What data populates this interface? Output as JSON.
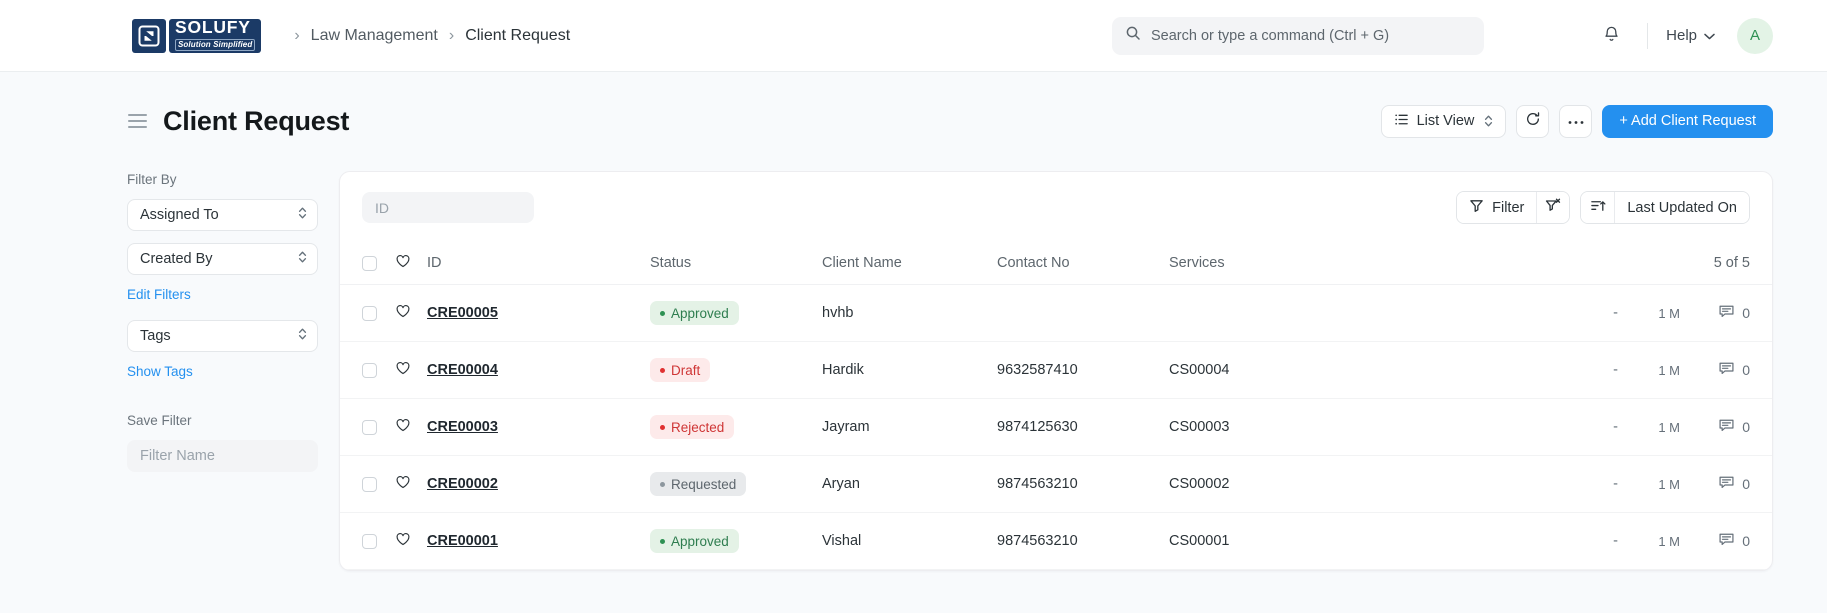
{
  "navbar": {
    "logo": {
      "name": "SOLUFY",
      "tagline": "Solution Simplified"
    },
    "breadcrumb": [
      {
        "label": "Law Management"
      },
      {
        "label": "Client Request"
      }
    ],
    "search": {
      "placeholder": "Search or type a command (Ctrl + G)",
      "value": ""
    },
    "help_label": "Help",
    "avatar_initial": "A"
  },
  "page": {
    "title": "Client Request",
    "actions": {
      "list_view_label": "List View",
      "add_label": "+ Add Client Request"
    }
  },
  "sidebar": {
    "filter_by_label": "Filter By",
    "filters": [
      {
        "label": "Assigned To"
      },
      {
        "label": "Created By"
      }
    ],
    "edit_filters_label": "Edit Filters",
    "tags_label": "Tags",
    "show_tags_label": "Show Tags",
    "save_filter_label": "Save Filter",
    "filter_name_placeholder": "Filter Name",
    "filter_name_value": ""
  },
  "list": {
    "toolbar": {
      "id_placeholder": "ID",
      "id_value": "",
      "filter_label": "Filter",
      "sort_label": "Last Updated On"
    },
    "columns": {
      "id": "ID",
      "status": "Status",
      "client_name": "Client Name",
      "contact_no": "Contact No",
      "services": "Services"
    },
    "count_label": "5 of 5",
    "rows": [
      {
        "id": "CRE00005",
        "status": "Approved",
        "status_tone": "green",
        "client_name": "hvhb",
        "contact_no": "",
        "services": "",
        "assigned": "-",
        "modified": "1 M",
        "comments": "0"
      },
      {
        "id": "CRE00004",
        "status": "Draft",
        "status_tone": "red",
        "client_name": "Hardik",
        "contact_no": "9632587410",
        "services": "CS00004",
        "assigned": "-",
        "modified": "1 M",
        "comments": "0"
      },
      {
        "id": "CRE00003",
        "status": "Rejected",
        "status_tone": "red",
        "client_name": "Jayram",
        "contact_no": "9874125630",
        "services": "CS00003",
        "assigned": "-",
        "modified": "1 M",
        "comments": "0"
      },
      {
        "id": "CRE00002",
        "status": "Requested",
        "status_tone": "gray",
        "client_name": "Aryan",
        "contact_no": "9874563210",
        "services": "CS00002",
        "assigned": "-",
        "modified": "1 M",
        "comments": "0"
      },
      {
        "id": "CRE00001",
        "status": "Approved",
        "status_tone": "green",
        "client_name": "Vishal",
        "contact_no": "9874563210",
        "services": "CS00001",
        "assigned": "-",
        "modified": "1 M",
        "comments": "0"
      }
    ]
  },
  "colors": {
    "brand_navy": "#1b3a66",
    "accent_blue": "#2490ef",
    "status_green": "#2e9153",
    "status_red": "#e03131",
    "status_gray": "#8d979e"
  }
}
